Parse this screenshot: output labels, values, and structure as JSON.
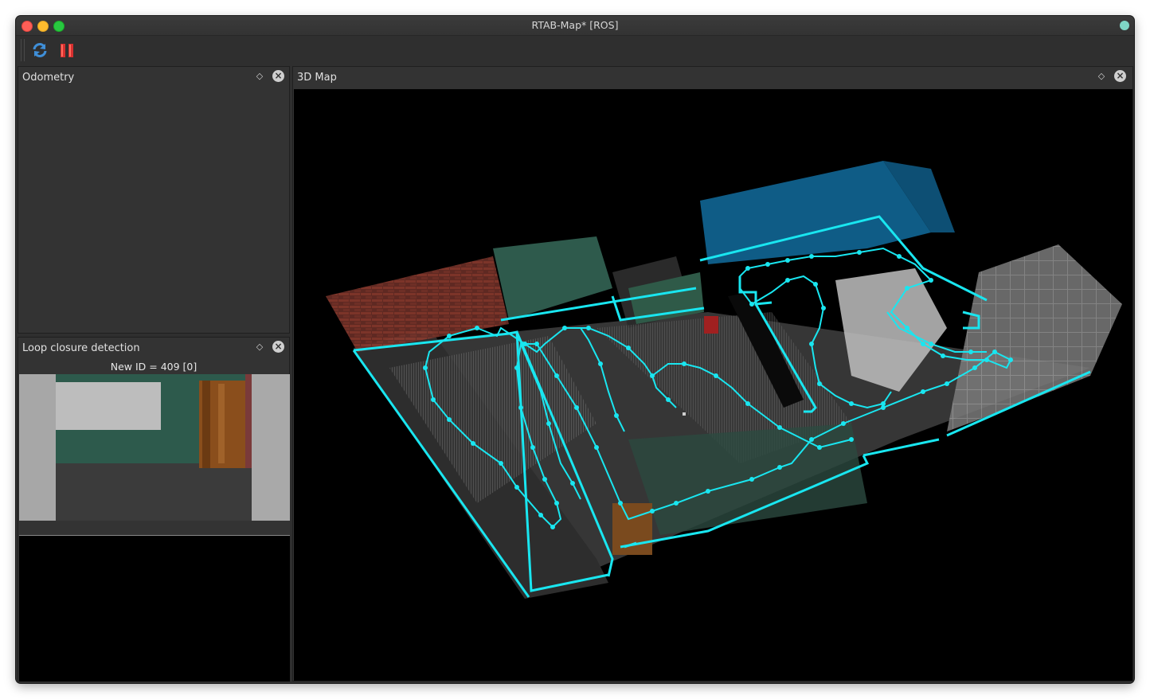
{
  "window": {
    "title": "RTAB-Map* [ROS]"
  },
  "toolbar": {
    "buttons": [
      {
        "name": "refresh",
        "icon": "refresh-icon"
      },
      {
        "name": "pause",
        "icon": "pause-icon"
      }
    ]
  },
  "docks": {
    "odometry": {
      "title": "Odometry",
      "float_icon": "◇",
      "close_icon": "×"
    },
    "loop_closure": {
      "title": "Loop closure detection",
      "float_icon": "◇",
      "close_icon": "×",
      "new_id_text": "New ID = 409 [0]"
    },
    "map3d": {
      "title": "3D Map",
      "float_icon": "◇",
      "close_icon": "×"
    }
  },
  "colors": {
    "trajectory": "#19e6f0",
    "background": "#000000",
    "panel": "#333333"
  }
}
